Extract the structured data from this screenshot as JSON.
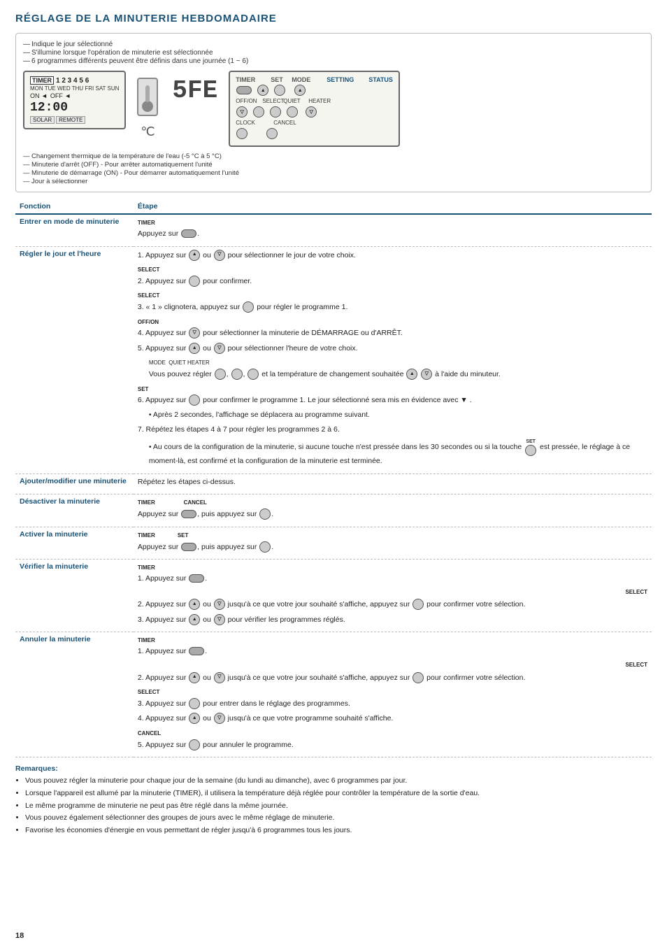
{
  "page": {
    "title": "RÉGLAGE DE LA MINUTERIE HEBDOMADAIRE",
    "page_number": "18"
  },
  "diagram": {
    "annotations_top": [
      "Indique le jour sélectionné",
      "S'illumine lorsque l'opération de minuterie est sélectionnée",
      "6 programmes différents peuvent être définis dans une journée (1 ~ 6)"
    ],
    "display": {
      "timer_label": "TIMER",
      "timer_numbers": "1 2 3 4 5 6",
      "days": "MON TUE WED THU FRI  SAT SUN",
      "on_label": "ON ◄",
      "off_label": "OFF ◄",
      "time": "12:00",
      "solar": "SOLAR",
      "remote": "REMOTE"
    },
    "temp_symbol": "℃",
    "sfe_display": "5FE",
    "control_panel": {
      "header_setting": "SETTING",
      "header_status": "STATUS",
      "timer_label": "TIMER",
      "set_label": "SET",
      "mode_label": "MODE",
      "off_on_label": "OFF/ON",
      "select_label": "SELECT",
      "quiet_label": "QUIET",
      "heater_label": "HEATER",
      "clock_label": "CLOCK",
      "cancel_label": "CANCEL"
    },
    "annotations_bottom": [
      "Changement thermique de la température de l'eau (-5 °C à 5 °C)",
      "Minuterie d'arrêt (OFF) - Pour arrêter automatiquement l'unité",
      "Minuterie de démarrage (ON) - Pour démarrer automatiquement l'unité",
      "Jour à sélectionner"
    ]
  },
  "table": {
    "col1": "Fonction",
    "col2": "Étape",
    "rows": [
      {
        "fonction": "Entrer en mode de minuterie",
        "etape_simple": "Appuyez sur [TIMER]."
      },
      {
        "fonction": "Régler le jour et l'heure",
        "etapes": [
          "1. Appuyez sur ▲ ou ▽ pour sélectionner le jour de votre choix.",
          "2. Appuyez sur [SELECT] pour confirmer.",
          "3. « 1 » clignotera, appuyez sur [SELECT] pour régler le programme 1.",
          "4. Appuyez sur [OFF/ON] pour sélectionner la minuterie de DÉMARRAGE ou d'ARRÊT.",
          "5. Appuyez sur ▲ ou ▽ pour sélectionner l'heure de votre choix.",
          "5b. Vous pouvez régler [MODE], [QUIET], [HEATER], et la température de changement souhaitée ▲ ▽ à l'aide du minuteur.",
          "6. Appuyez sur [SET] pour confirmer le programme 1. Le jour sélectionné sera mis en évidence avec ▼ .",
          "6b. • Après 2 secondes, l'affichage se déplacera au programme suivant.",
          "7. Répétez les étapes 4 à 7 pour régler les programmes 2 à 6.",
          "7b. • Au cours de la configuration de la minuterie, si aucune touche n'est pressée dans les 30 secondes ou si la touche [SET] est pressée, le réglage à ce moment-là, est confirmé et la configuration de la minuterie est terminée."
        ]
      },
      {
        "fonction": "Ajouter/modifier une minuterie",
        "etape_simple": "Répétez les étapes ci-dessus."
      },
      {
        "fonction": "Désactiver la minuterie",
        "etape_simple": "Appuyez sur [TIMER], puis appuyez sur [CANCEL]."
      },
      {
        "fonction": "Activer la minuterie",
        "etape_simple": "Appuyez sur [TIMER], puis appuyez sur [SET]."
      },
      {
        "fonction": "Vérifier la minuterie",
        "etapes": [
          "1. Appuyez sur [TIMER].",
          "2. Appuyez sur ▲ ou ▽ jusqu'à ce que votre jour souhaité s'affiche, appuyez sur [SELECT] pour confirmer votre sélection.",
          "3. Appuyez sur ▲ ou ▽ pour vérifier les programmes réglés."
        ]
      },
      {
        "fonction": "Annuler la minuterie",
        "etapes": [
          "1. Appuyez sur [TIMER].",
          "2. Appuyez sur ▲ ou ▽ jusqu'à ce que votre jour souhaité s'affiche, appuyez sur [SELECT] pour confirmer votre sélection.",
          "3. Appuyez sur [SELECT] pour entrer dans le réglage des programmes.",
          "4. Appuyez sur ▲ ou ▽ jusqu'à ce que votre programme souhaité s'affiche.",
          "5. Appuyez sur [CANCEL] pour annuler le programme."
        ]
      }
    ]
  },
  "remarks": {
    "title": "Remarques:",
    "items": [
      "Vous pouvez régler la minuterie pour chaque jour de la semaine (du lundi au dimanche), avec 6 programmes par jour.",
      "Lorsque l'appareil est allumé par la minuterie (TIMER), il utilisera la température déjà réglée pour contrôler la température de la sortie d'eau.",
      "Le même programme de minuterie ne peut pas être réglé dans la même journée.",
      "Vous pouvez également sélectionner des groupes de jours avec le même réglage de minuterie.",
      "Favorise les économies d'énergie en vous permettant de régler jusqu'à 6 programmes tous les jours."
    ]
  }
}
